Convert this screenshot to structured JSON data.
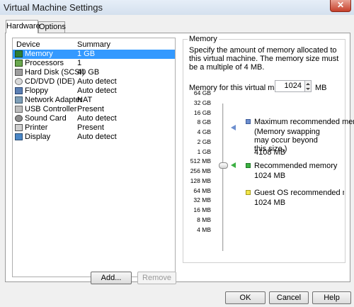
{
  "window": {
    "title": "Virtual Machine Settings",
    "close_glyph": "✕"
  },
  "tabs": [
    {
      "label": "Hardware",
      "active": true
    },
    {
      "label": "Options",
      "active": false
    }
  ],
  "device_list": {
    "col_device": "Device",
    "col_summary": "Summary",
    "selected_index": 0,
    "rows": [
      {
        "name": "Memory",
        "summary": "1 GB",
        "icon": "memory-icon"
      },
      {
        "name": "Processors",
        "summary": "1",
        "icon": "processor-icon"
      },
      {
        "name": "Hard Disk (SCSI)",
        "summary": "40 GB",
        "icon": "hard-disk-icon"
      },
      {
        "name": "CD/DVD (IDE)",
        "summary": "Auto detect",
        "icon": "cd-dvd-icon"
      },
      {
        "name": "Floppy",
        "summary": "Auto detect",
        "icon": "floppy-icon"
      },
      {
        "name": "Network Adapter",
        "summary": "NAT",
        "icon": "network-adapter-icon"
      },
      {
        "name": "USB Controller",
        "summary": "Present",
        "icon": "usb-controller-icon"
      },
      {
        "name": "Sound Card",
        "summary": "Auto detect",
        "icon": "sound-card-icon"
      },
      {
        "name": "Printer",
        "summary": "Present",
        "icon": "printer-icon"
      },
      {
        "name": "Display",
        "summary": "Auto detect",
        "icon": "display-icon"
      }
    ]
  },
  "device_buttons": {
    "add": "Add...",
    "remove": "Remove"
  },
  "memory": {
    "group_title": "Memory",
    "description": "Specify the amount of memory allocated to this virtual machine. The memory size must be a multiple of 4 MB.",
    "field_label": "Memory for this virtual machine:",
    "value": "1024",
    "unit": "MB",
    "scale": [
      "64 GB",
      "32 GB",
      "16 GB",
      "8 GB",
      "4 GB",
      "2 GB",
      "1 GB",
      "512 MB",
      "256 MB",
      "128 MB",
      "64 MB",
      "32 MB",
      "16 MB",
      "8 MB",
      "4 MB"
    ],
    "max_recommended": {
      "label": "Maximum recommended memory",
      "note": "(Memory swapping may occur beyond this size.)",
      "value": "4108 MB",
      "color": "#6d8fcf"
    },
    "recommended": {
      "label": "Recommended memory",
      "value": "1024 MB",
      "color": "#3cb043"
    },
    "guest_os": {
      "label": "Guest OS recommended minimum",
      "value": "1024 MB",
      "color": "#f2e64a"
    }
  },
  "dialog_buttons": {
    "ok": "OK",
    "cancel": "Cancel",
    "help": "Help"
  }
}
